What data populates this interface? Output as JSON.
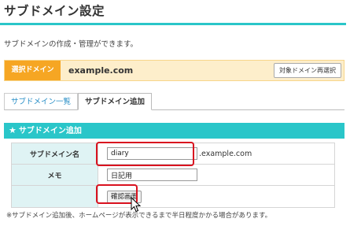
{
  "page": {
    "title": "サブドメイン設定",
    "intro": "サブドメインの作成・管理ができます。"
  },
  "domain_bar": {
    "label": "選択ドメイン",
    "value": "example.com",
    "reselect_label": "対象ドメイン再選択"
  },
  "tabs": [
    {
      "label": "サブドメイン一覧",
      "active": false
    },
    {
      "label": "サブドメイン追加",
      "active": true
    }
  ],
  "section": {
    "title": "サブドメイン追加"
  },
  "form": {
    "subdomain_label": "サブドメイン名",
    "subdomain_value": "diary",
    "subdomain_suffix": ".example.com",
    "memo_label": "メモ",
    "memo_value": "日記用",
    "confirm_label": "確認画面"
  },
  "note": "※サブドメイン追加後、ホームページが表示できるまで半日程度かかる場合があります。",
  "colors": {
    "accent": "#2ac6c9",
    "domain_label_bg": "#f6a623",
    "highlight": "#d9121f"
  }
}
